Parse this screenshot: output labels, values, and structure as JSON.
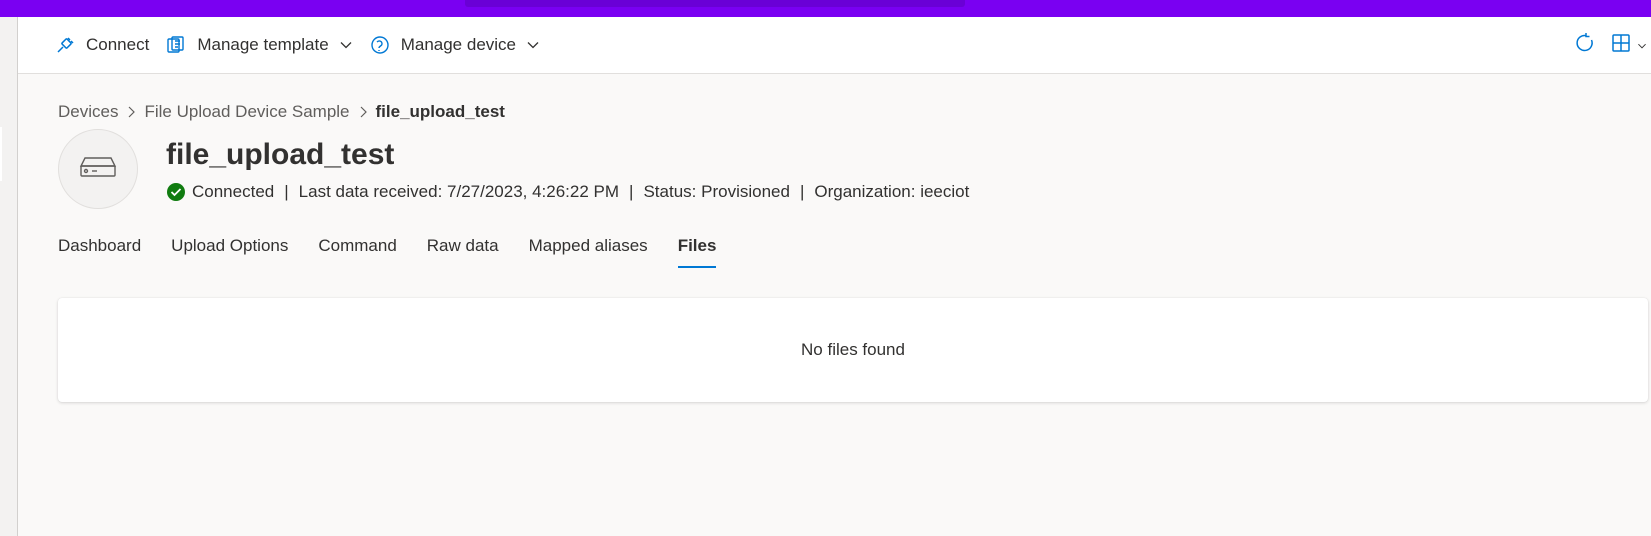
{
  "command_bar": {
    "connect_label": "Connect",
    "manage_template_label": "Manage template",
    "manage_device_label": "Manage device"
  },
  "breadcrumb": {
    "items": [
      "Devices",
      "File Upload Device Sample"
    ],
    "current": "file_upload_test"
  },
  "device": {
    "name": "file_upload_test",
    "connection_status": "Connected",
    "last_data": "Last data received: 7/27/2023, 4:26:22 PM",
    "status": "Status: Provisioned",
    "organization": "Organization: ieeciot",
    "separator": "|"
  },
  "tabs": [
    {
      "label": "Dashboard"
    },
    {
      "label": "Upload Options"
    },
    {
      "label": "Command"
    },
    {
      "label": "Raw data"
    },
    {
      "label": "Mapped aliases"
    },
    {
      "label": "Files",
      "active": true
    }
  ],
  "files": {
    "empty_message": "No files found"
  },
  "colors": {
    "top_bar": "#7a00f2",
    "accent": "#0078d4",
    "connected_green": "#107c10"
  },
  "icons": {
    "connect": "plug-icon",
    "manage_template": "template-icon",
    "manage_device": "device-manage-icon",
    "refresh": "refresh-icon",
    "layout": "grid-layout-icon",
    "device": "device-icon",
    "status": "check-circle-icon"
  }
}
